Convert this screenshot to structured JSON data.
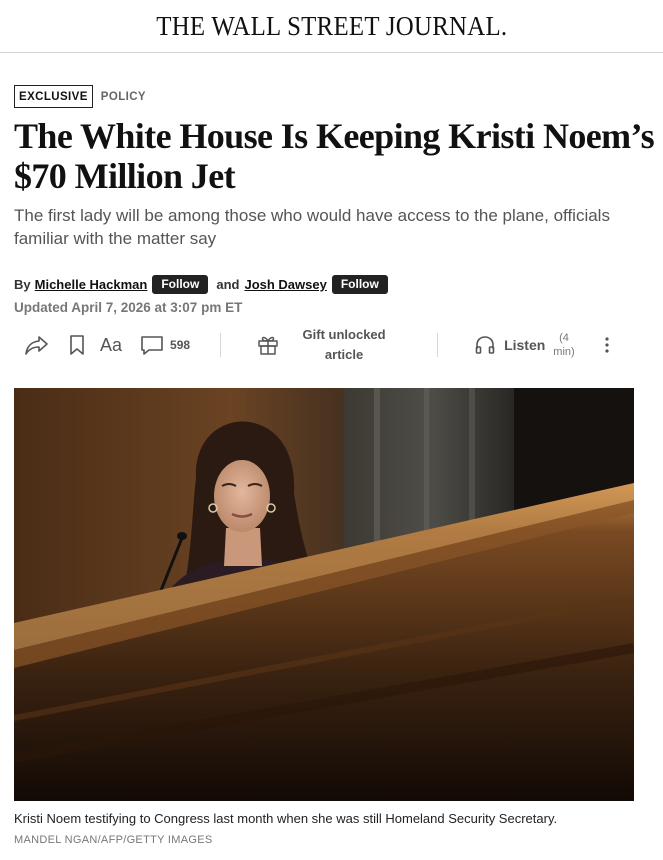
{
  "masthead": {
    "title": "THE WALL STREET JOURNAL."
  },
  "flags": {
    "exclusive": "EXCLUSIVE",
    "section": "POLICY"
  },
  "article": {
    "headline": "The White House Is Keeping Kristi Noem’s $70 Million Jet",
    "dek": "The first lady will be among those who would have access to the plane, officials familiar with the matter say"
  },
  "byline": {
    "by": "By",
    "author1": "Michelle Hackman",
    "follow1": "Follow",
    "and": "and",
    "author2": "Josh Dawsey",
    "follow2": "Follow",
    "updated": "Updated April 7, 2026 at 3:07 pm ET"
  },
  "toolbar": {
    "share_icon": "share-arrow-icon",
    "bookmark_icon": "bookmark-icon",
    "text_size_icon": "text-size-icon",
    "text_size_label": "Aa",
    "comment_icon": "comment-bubble-icon",
    "comment_count": "598",
    "gift_icon": "gift-box-icon",
    "gift_line1": "Gift unlocked",
    "gift_line2": "article",
    "listen_icon": "headphones-icon",
    "listen_label": "Listen",
    "listen_dur1": "(4",
    "listen_dur2": "min)",
    "more_icon": "vertical-ellipsis-icon"
  },
  "photo": {
    "caption": "Kristi Noem testifying to Congress last month when she was still Homeland Security Secretary.",
    "credit": "MANDEL NGAN/AFP/GETTY IMAGES"
  },
  "colors": {
    "follow_bg": "#222222",
    "meta_gray": "#777777",
    "dek_gray": "#555555"
  }
}
